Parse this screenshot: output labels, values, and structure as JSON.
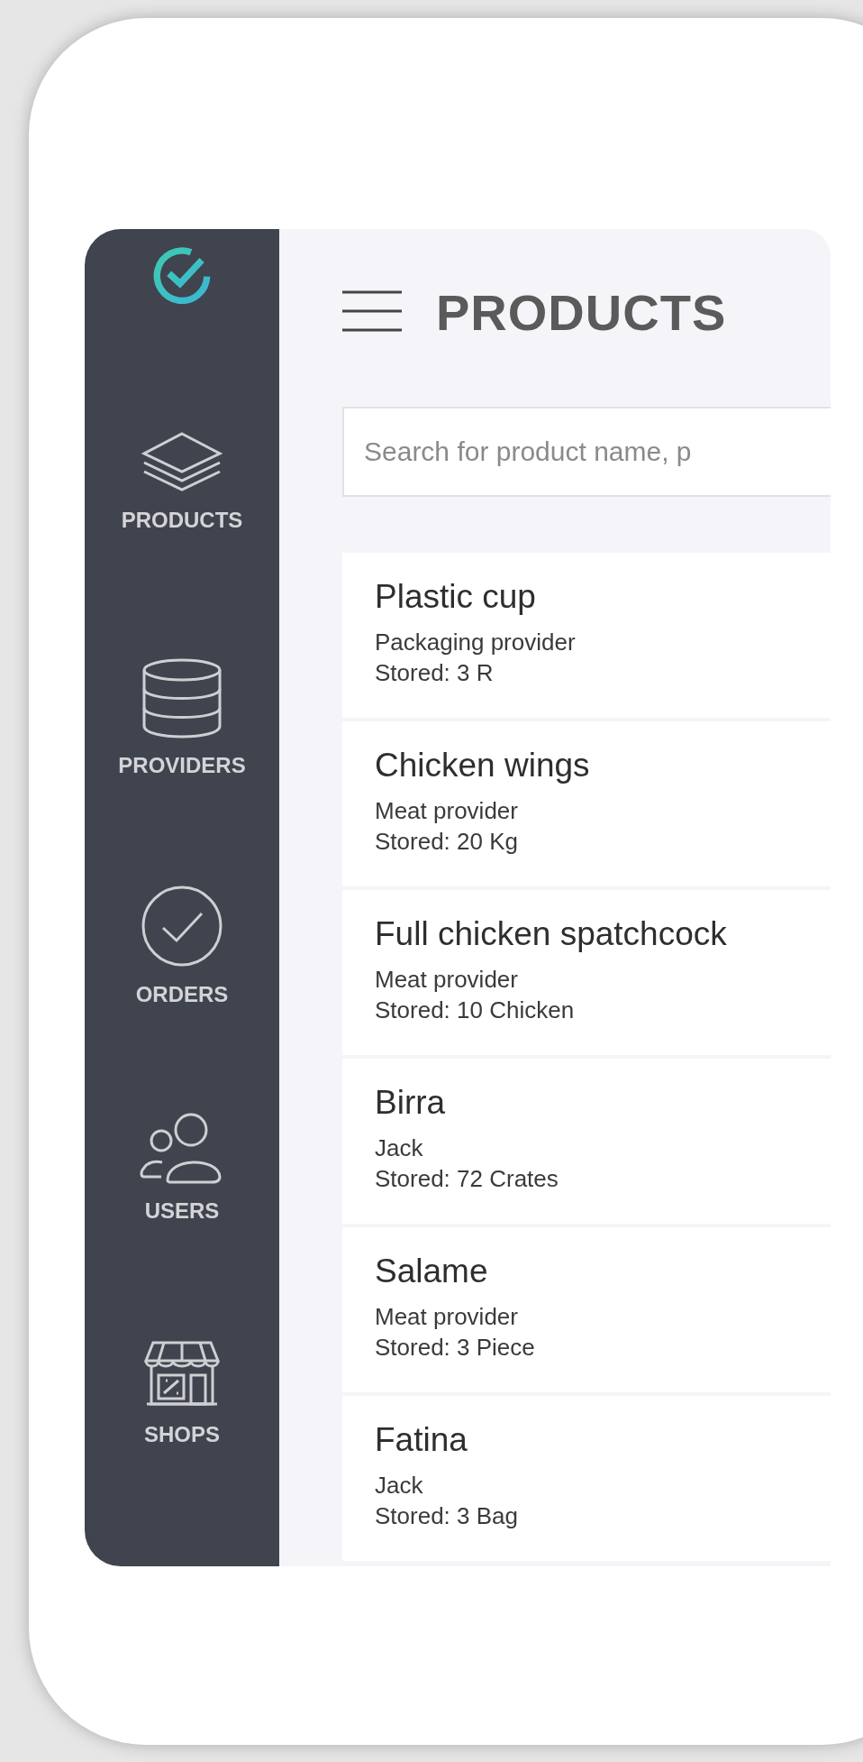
{
  "sidebar": {
    "items": [
      {
        "kind": "layers",
        "label": "PRODUCTS"
      },
      {
        "kind": "database",
        "label": "PROVIDERS"
      },
      {
        "kind": "check",
        "label": "ORDERS"
      },
      {
        "kind": "users",
        "label": "USERS"
      },
      {
        "kind": "shop",
        "label": "SHOPS"
      }
    ]
  },
  "header": {
    "title": "PRODUCTS"
  },
  "search": {
    "placeholder": "Search for product name, p"
  },
  "products": [
    {
      "name": "Plastic cup",
      "provider": "Packaging provider",
      "stored": "Stored: 3 R"
    },
    {
      "name": "Chicken wings",
      "provider": "Meat provider",
      "stored": "Stored: 20 Kg"
    },
    {
      "name": "Full chicken spatchcock",
      "provider": "Meat provider",
      "stored": "Stored: 10 Chicken"
    },
    {
      "name": "Birra",
      "provider": "Jack",
      "stored": "Stored: 72 Crates"
    },
    {
      "name": "Salame",
      "provider": "Meat provider",
      "stored": "Stored: 3 Piece"
    },
    {
      "name": "Fatina",
      "provider": "Jack",
      "stored": "Stored: 3 Bag"
    }
  ]
}
